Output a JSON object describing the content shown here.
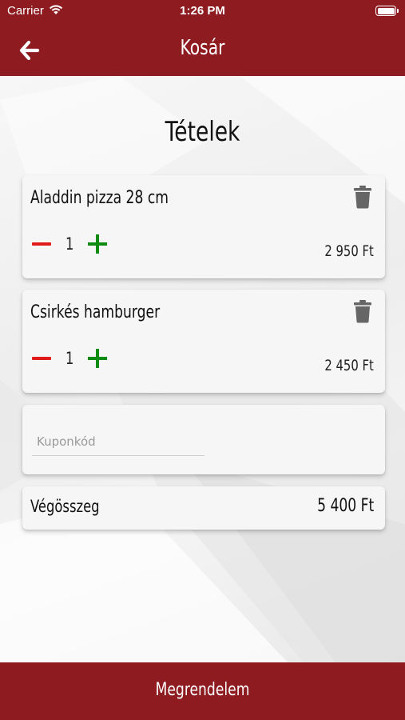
{
  "status_bar": {
    "carrier": "Carrier",
    "time": "1:26 PM"
  },
  "nav": {
    "title": "Kosár",
    "back_icon": "arrow-left-icon"
  },
  "section_title": "Tételek",
  "items": [
    {
      "name": "Aladdin pizza 28 cm",
      "quantity": "1",
      "price": "2 950 Ft"
    },
    {
      "name": "Csirkés hamburger",
      "quantity": "1",
      "price": "2 450 Ft"
    }
  ],
  "coupon": {
    "placeholder": "Kuponkód",
    "value": ""
  },
  "total": {
    "label": "Végösszeg",
    "value": "5 400 Ft"
  },
  "order_button_label": "Megrendelem",
  "colors": {
    "brand": "#8e1b1f",
    "minus": "#e01919",
    "plus": "#0e8c12",
    "trash": "#666666"
  }
}
